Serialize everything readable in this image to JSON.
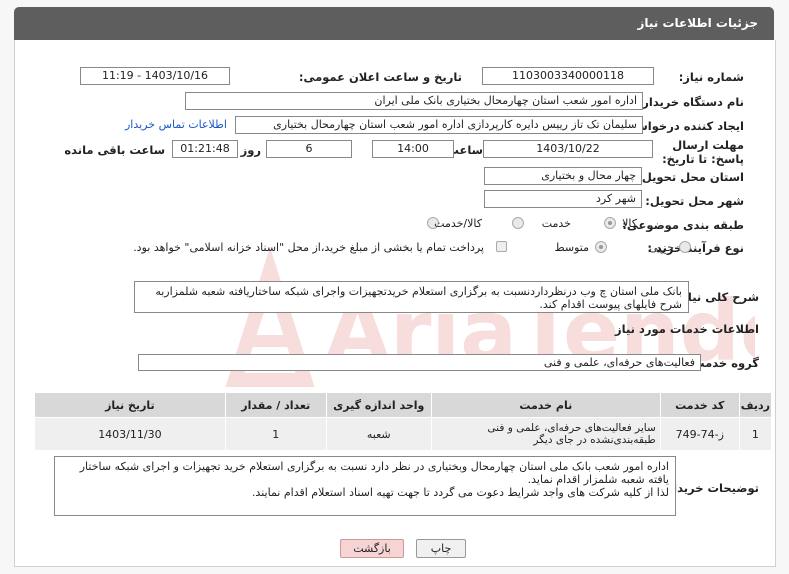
{
  "header": {
    "title": "جزئیات اطلاعات نیاز"
  },
  "fields": {
    "need_number_label": "شماره نیاز:",
    "need_number": "1103003340000118",
    "announce_label": "تاریخ و ساعت اعلان عمومی:",
    "announce_value": "1403/10/16 - 11:19",
    "buyer_org_label": "نام دستگاه خریدار:",
    "buyer_org": "اداره امور شعب استان چهارمحال بختیاری بانک ملی ایران",
    "creator_label": "ایجاد کننده درخواست:",
    "creator": "سلیمان تک تاز رییس دایره کارپردازی  اداره امور شعب استان چهارمحال بختیاری",
    "contact_link": "اطلاعات تماس خریدار",
    "deadline_label": "مهلت ارسال پاسخ: تا تاریخ:",
    "deadline_date": "1403/10/22",
    "time_label": "ساعت",
    "deadline_time": "14:00",
    "days_value": "6",
    "days_label": "روز و",
    "remaining_time": "01:21:48",
    "remaining_label": "ساعت باقی مانده",
    "province_label": "استان محل تحویل:",
    "province": "چهار محال و بختیاری",
    "city_label": "شهر محل تحویل:",
    "city": "شهر کرد",
    "category_label": "طبقه بندی موضوعی:",
    "category_options": [
      "کالا",
      "خدمت",
      "کالا/خدمت"
    ],
    "process_label": "نوع فرآیند خرید :",
    "process_options": [
      "جزیی",
      "متوسط"
    ],
    "payment_note": "پرداخت تمام یا بخشی از مبلغ خرید،از محل \"اسناد خزانه اسلامی\" خواهد بود."
  },
  "summary": {
    "label": "شرح کلی نیاز:",
    "text": "بانک ملی استان چ وب درنظرداردنسبت به برگزاری استعلام خریدتجهیزات واجرای شبکه ساختاریافته شعبه شلمزاربه شرح فایلهای پیوست اقدام کند."
  },
  "services": {
    "section_title": "اطلاعات خدمات مورد نیاز",
    "group_label": "گروه خدمت:",
    "group_value": "فعالیت‌های حرفه‌ای، علمی و فنی",
    "columns": [
      "ردیف",
      "کد خدمت",
      "نام خدمت",
      "واحد اندازه گیری",
      "تعداد / مقدار",
      "تاریخ نیاز"
    ],
    "rows": [
      [
        "1",
        "ز-74-749",
        "سایر فعالیت‌های حرفه‌ای، علمی و فنی طبقه‌بندی‌نشده در جای دیگر",
        "شعبه",
        "1",
        "1403/11/30"
      ]
    ]
  },
  "buyer_notes": {
    "label": "توضیحات خریدار:",
    "line1": "اداره امور شعب بانک ملی استان چهارمحال وبختیاری در نظر دارد نسبت به برگزاری استعلام خرید تجهیزات و اجرای شبکه ساختار یافته شعبه شلمزار اقدام نماید.",
    "line2": "لذا از کلیه شرکت های واجد شرایط دعوت می گردد تا جهت تهیه اسناد استعلام اقدام نمایند."
  },
  "buttons": {
    "print": "چاپ",
    "back": "بازگشت"
  },
  "watermark": {
    "text": "AriaTender.neT"
  },
  "colors": {
    "header_bg": "#5e5e5e",
    "link": "#1a57c9",
    "back_btn_bg": "#f6d4d4",
    "print_btn_bg": "#f0f0f0"
  }
}
